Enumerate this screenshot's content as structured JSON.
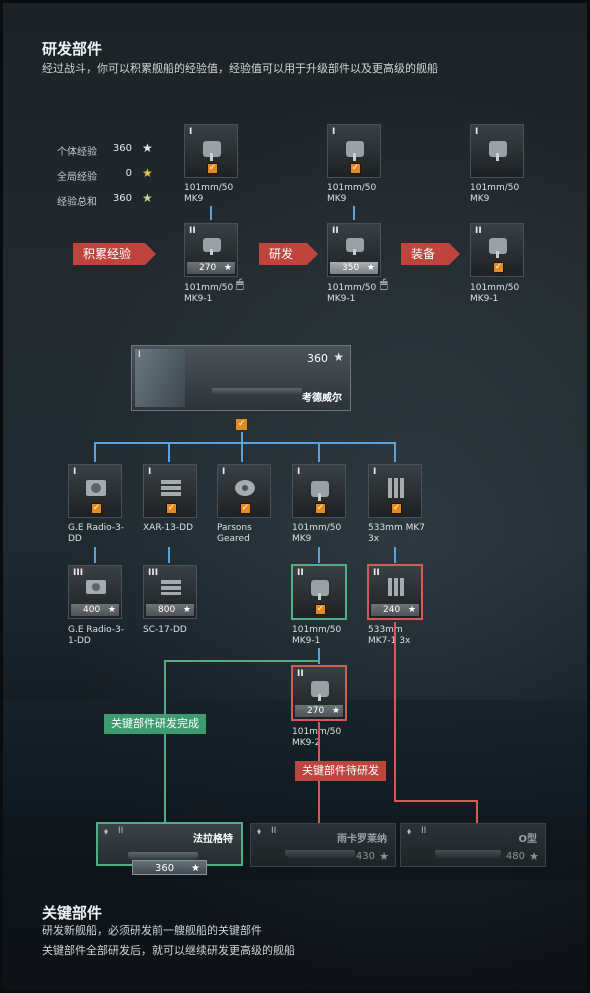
{
  "header": {
    "title": "研发部件",
    "subtitle": "经过战斗，你可以积累舰船的经验值，经验值可以用于升级部件以及更高级的舰船"
  },
  "xp_panel": [
    {
      "label": "个体经验",
      "value": "360",
      "star_color": "#e8e8e8"
    },
    {
      "label": "全局经验",
      "value": "0",
      "star_color": "#e6c34a"
    },
    {
      "label": "经验总和",
      "value": "360",
      "star_color": "#c9cf8a"
    }
  ],
  "steps": {
    "accumulate": "积累经验",
    "research": "研发",
    "equip": "装备"
  },
  "demo_columns": [
    {
      "top": {
        "tier": "I",
        "name_line1": "101mm/50",
        "name_line2": "MK9",
        "checked": true
      },
      "bottom": {
        "tier": "II",
        "cost": "270",
        "name_line1": "101mm/50",
        "name_line2": "MK9-1"
      }
    },
    {
      "top": {
        "tier": "I",
        "name_line1": "101mm/50",
        "name_line2": "MK9",
        "checked": true
      },
      "bottom": {
        "tier": "II",
        "cost": "350",
        "name_line1": "101mm/50",
        "name_line2": "MK9-1"
      }
    },
    {
      "top": {
        "tier": "I",
        "name_line1": "101mm/50",
        "name_line2": "MK9",
        "checked": false
      },
      "bottom": {
        "tier": "II",
        "checked": true,
        "name_line1": "101mm/50",
        "name_line2": "MK9-1"
      }
    }
  ],
  "ship": {
    "tier": "I",
    "xp": "360",
    "name": "考德威尔"
  },
  "tree_row1": [
    {
      "tier": "I",
      "name_line1": "G.E Radio-3-",
      "name_line2": "DD",
      "icon": "radio-icon"
    },
    {
      "tier": "I",
      "name_line1": "XAR-13-DD",
      "name_line2": "",
      "icon": "torpedo-rack-icon"
    },
    {
      "tier": "I",
      "name_line1": "Parsons",
      "name_line2": "Geared",
      "icon": "turbine-icon"
    },
    {
      "tier": "I",
      "name_line1": "101mm/50",
      "name_line2": "MK9",
      "icon": "gun-turret-icon"
    },
    {
      "tier": "I",
      "name_line1": "533mm MK7",
      "name_line2": "3x",
      "icon": "torpedo-tube-icon"
    }
  ],
  "tree_row2": [
    {
      "tier": "III",
      "cost": "400",
      "name_line1": "G.E Radio-3-",
      "name_line2": "1-DD"
    },
    {
      "tier": "III",
      "cost": "800",
      "name_line1": "SC-17-DD",
      "name_line2": ""
    },
    {
      "tier": "II",
      "name_line1": "101mm/50",
      "name_line2": "MK9-1"
    },
    {
      "tier": "II",
      "cost": "240",
      "name_line1": "533mm",
      "name_line2": "MK7-1 3x"
    }
  ],
  "tree_row3": {
    "tier": "II",
    "cost": "270",
    "name_line1": "101mm/50",
    "name_line2": "MK9-2"
  },
  "labels": {
    "done": "关键部件研发完成",
    "pending": "关键部件待研发"
  },
  "next_ships": [
    {
      "tier": "II",
      "name": "法拉格特",
      "xp": "360"
    },
    {
      "tier": "II",
      "name": "雨卡罗莱纳",
      "xp": "430"
    },
    {
      "tier": "II",
      "name": "O型",
      "xp": "480"
    }
  ],
  "footer": {
    "title": "关键部件",
    "line1": "研发新舰船，必须研发前一艘舰船的关键部件",
    "line2": "关键部件全部研发后，就可以继续研发更高级的舰船"
  }
}
